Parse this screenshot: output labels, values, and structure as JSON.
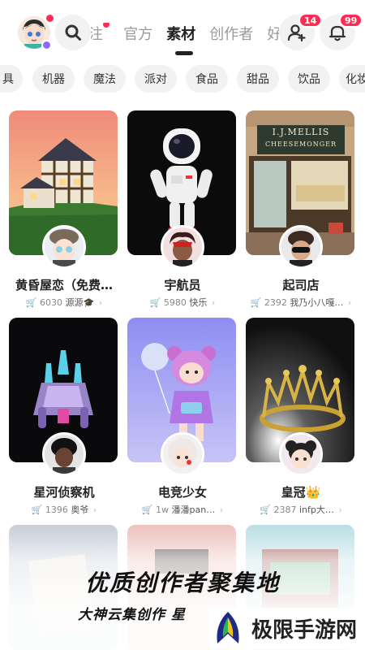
{
  "header": {
    "tabs": [
      {
        "label": "注",
        "active": false
      },
      {
        "label": "官方",
        "active": false
      },
      {
        "label": "素材",
        "active": true
      },
      {
        "label": "创作者",
        "active": false
      },
      {
        "label": "好",
        "active": false
      }
    ],
    "friends_badge": "14",
    "notifications_badge": "99"
  },
  "categories": [
    "具",
    "机器",
    "魔法",
    "派对",
    "食品",
    "甜品",
    "饮品",
    "化妆"
  ],
  "cards": [
    {
      "title": "黄昏屋恋（免费…",
      "count": "6030",
      "author": "源源🎓"
    },
    {
      "title": "宇航员",
      "count": "5980",
      "author": "快乐"
    },
    {
      "title": "起司店",
      "count": "2392",
      "author": "我乃小八嘎…"
    },
    {
      "title": "星河侦察机",
      "count": "1396",
      "author": "奥爷"
    },
    {
      "title": "电竞少女",
      "count": "1w",
      "author": "潘潘pan…"
    },
    {
      "title": "皇冠👑",
      "count": "2387",
      "author": "infp大…"
    }
  ],
  "cheese_sign": {
    "line1": "I.J.MELLIS",
    "line2": "CHEESEMONGER"
  },
  "promo": {
    "title": "优质创作者聚集地",
    "subtitle": "大神云集创作 星",
    "brand": "极限手游网"
  },
  "colors": {
    "accent": "#ff2d55",
    "chip_bg": "#f2f2f2"
  }
}
